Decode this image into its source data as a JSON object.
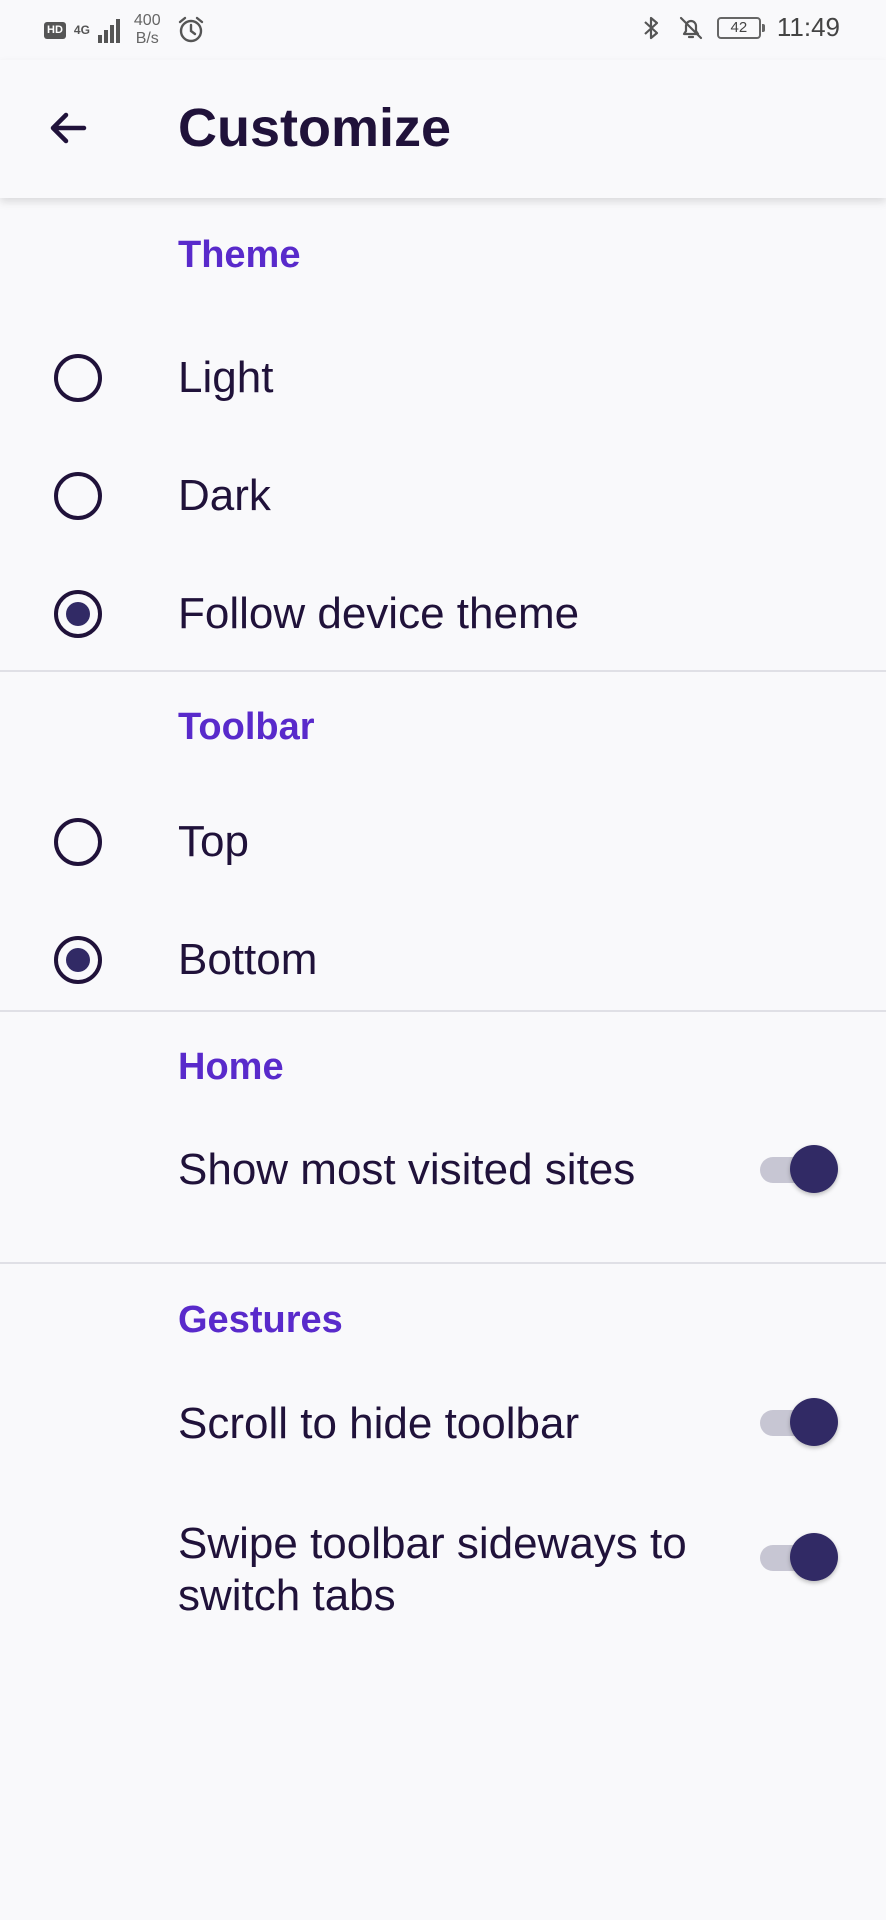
{
  "status_bar": {
    "hd": "HD",
    "network": "4G",
    "speed_value": "400",
    "speed_unit": "B/s",
    "battery": "42",
    "time": "11:49"
  },
  "app_bar": {
    "title": "Customize"
  },
  "sections": {
    "theme": {
      "header": "Theme",
      "options": [
        "Light",
        "Dark",
        "Follow device theme"
      ],
      "selected": "Follow device theme"
    },
    "toolbar": {
      "header": "Toolbar",
      "options": [
        "Top",
        "Bottom"
      ],
      "selected": "Bottom"
    },
    "home": {
      "header": "Home",
      "items": [
        {
          "label": "Show most visited sites",
          "enabled": true
        }
      ]
    },
    "gestures": {
      "header": "Gestures",
      "items": [
        {
          "label": "Scroll to hide toolbar",
          "enabled": true
        },
        {
          "label": "Swipe toolbar sideways to switch tabs",
          "enabled": true
        }
      ]
    }
  },
  "colors": {
    "accent": "#592acb",
    "text": "#20123a",
    "control": "#312a65",
    "background": "#f9f9fb"
  }
}
